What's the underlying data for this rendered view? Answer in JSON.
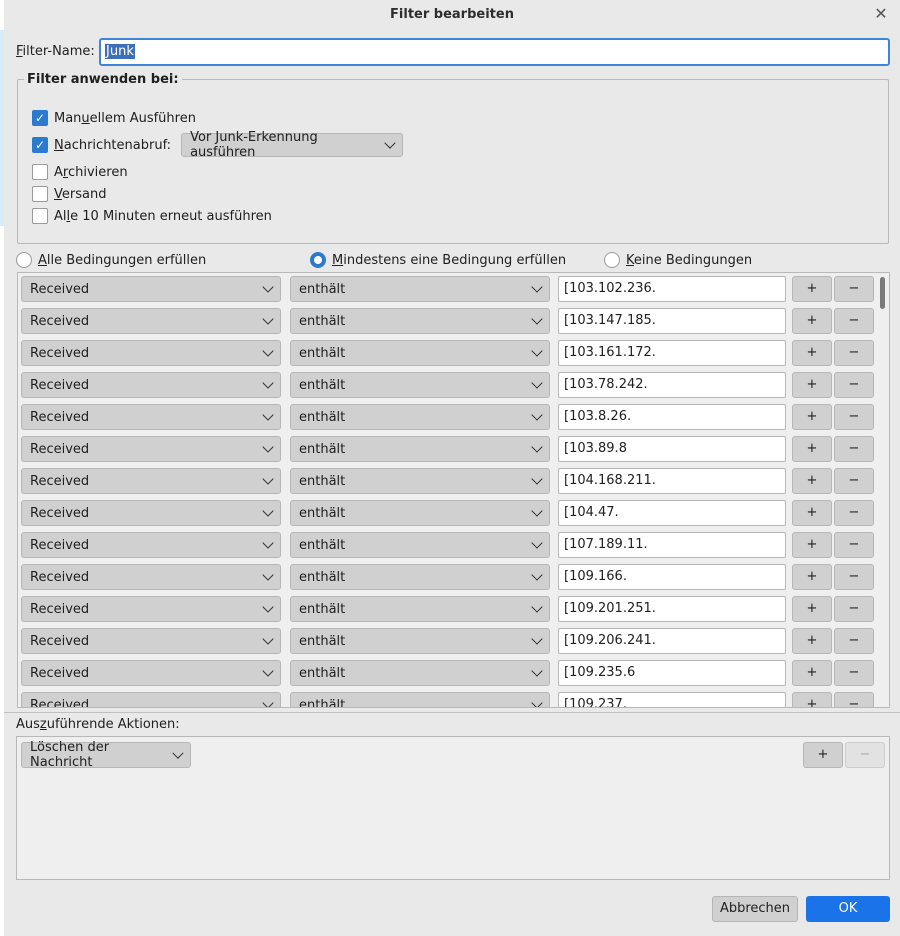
{
  "window": {
    "title": "Filter bearbeiten",
    "close_icon": "close-icon"
  },
  "filter_name": {
    "label": "Filter-Name:",
    "value": "Junk"
  },
  "apply_to": {
    "legend": "Filter anwenden bei:",
    "manual": {
      "label": "Manuellem Ausführen",
      "checked": true
    },
    "fetch": {
      "label": "Nachrichtenabruf:",
      "checked": true,
      "dropdown": "Vor Junk-Erkennung ausführen"
    },
    "archive": {
      "label": "Archivieren",
      "checked": false
    },
    "send": {
      "label": "Versand",
      "checked": false
    },
    "periodic": {
      "label": "Alle 10 Minuten erneut ausführen",
      "checked": false
    }
  },
  "match": {
    "all": "Alle Bedingungen erfüllen",
    "any": "Mindestens eine Bedingung erfüllen",
    "none": "Keine Bedingungen",
    "selected": "any"
  },
  "conditions": [
    {
      "field": "Received",
      "op": "enthält",
      "value": "[103.102.236."
    },
    {
      "field": "Received",
      "op": "enthält",
      "value": "[103.147.185."
    },
    {
      "field": "Received",
      "op": "enthält",
      "value": "[103.161.172."
    },
    {
      "field": "Received",
      "op": "enthält",
      "value": "[103.78.242."
    },
    {
      "field": "Received",
      "op": "enthält",
      "value": "[103.8.26."
    },
    {
      "field": "Received",
      "op": "enthält",
      "value": "[103.89.8"
    },
    {
      "field": "Received",
      "op": "enthält",
      "value": "[104.168.211."
    },
    {
      "field": "Received",
      "op": "enthält",
      "value": "[104.47."
    },
    {
      "field": "Received",
      "op": "enthält",
      "value": "[107.189.11."
    },
    {
      "field": "Received",
      "op": "enthält",
      "value": "[109.166."
    },
    {
      "field": "Received",
      "op": "enthält",
      "value": "[109.201.251."
    },
    {
      "field": "Received",
      "op": "enthält",
      "value": "[109.206.241."
    },
    {
      "field": "Received",
      "op": "enthält",
      "value": "[109.235.6"
    },
    {
      "field": "Received",
      "op": "enthält",
      "value": "[109.237."
    }
  ],
  "plus_label": "+",
  "minus_label": "−",
  "actions": {
    "label": "Auszuführende Aktionen:",
    "action": "Löschen der Nachricht"
  },
  "buttons": {
    "cancel": "Abbrechen",
    "ok": "OK"
  },
  "colors": {
    "accent": "#1a73e8",
    "checkbox": "#2a7bd0"
  }
}
